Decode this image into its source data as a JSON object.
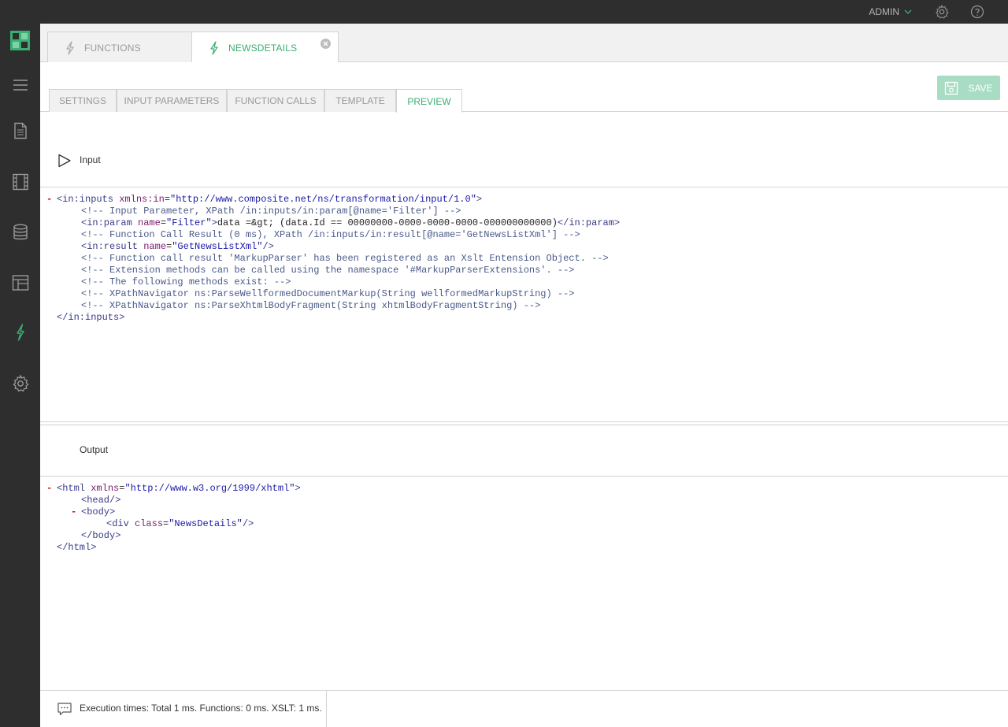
{
  "topbar": {
    "user_label": "ADMIN",
    "icons": [
      "gear-icon",
      "help-icon"
    ]
  },
  "sidebar": {
    "items": [
      {
        "name": "menu-icon"
      },
      {
        "name": "pages-icon"
      },
      {
        "name": "media-icon"
      },
      {
        "name": "data-icon"
      },
      {
        "name": "layout-icon"
      },
      {
        "name": "functions-icon",
        "active": true
      },
      {
        "name": "settings-icon"
      }
    ]
  },
  "doc_tabs": [
    {
      "label": "FUNCTIONS",
      "active": false
    },
    {
      "label": "NEWSDETAILS",
      "active": true
    }
  ],
  "toolbar": {
    "save_label": "SAVE"
  },
  "sub_tabs": [
    {
      "label": "SETTINGS"
    },
    {
      "label": "INPUT PARAMETERS"
    },
    {
      "label": "FUNCTION CALLS"
    },
    {
      "label": "TEMPLATE"
    },
    {
      "label": "PREVIEW",
      "active": true
    }
  ],
  "input_section": {
    "label": "Input",
    "lines": {
      "l1_open": "<in:inputs ",
      "l1_attr": "xmlns:in",
      "l1_eq": "=",
      "l1_val": "\"http://www.composite.net/ns/transformation/input/1.0\"",
      "l1_close": ">",
      "l2": "<!-- Input Parameter, XPath /in:inputs/in:param[@name='Filter'] -->",
      "l3_open": "<in:param ",
      "l3_attr": "name",
      "l3_val": "\"Filter\"",
      "l3_close": ">",
      "l3_text": "data =&gt; (data.Id == 00000000-0000-0000-0000-000000000000)",
      "l3_end": "</in:param>",
      "l4": "<!-- Function Call Result (0 ms), XPath /in:inputs/in:result[@name='GetNewsListXml'] -->",
      "l5_open": "<in:result ",
      "l5_attr": "name",
      "l5_val": "\"GetNewsListXml\"",
      "l5_close": "/>",
      "l6": "<!-- Function call result 'MarkupParser' has been registered as an Xslt Entension Object. -->",
      "l7": "<!-- Extension methods can be called using the namespace '#MarkupParserExtensions'. -->",
      "l8": "<!-- The following methods exist: -->",
      "l9": "<!-- XPathNavigator ns:ParseWellformedDocumentMarkup(String wellformedMarkupString) -->",
      "l10": "<!-- XPathNavigator ns:ParseXhtmlBodyFragment(String xhtmlBodyFragmentString) -->",
      "l11": "</in:inputs>"
    }
  },
  "output_section": {
    "label": "Output",
    "lines": {
      "l1_open": "<html ",
      "l1_attr": "xmlns",
      "l1_val": "\"http://www.w3.org/1999/xhtml\"",
      "l1_close": ">",
      "l2": "<head/>",
      "l3": "<body>",
      "l4_open": "<div ",
      "l4_attr": "class",
      "l4_val": "\"NewsDetails\"",
      "l4_close": "/>",
      "l5": "</body>",
      "l6": "</html>"
    }
  },
  "status": {
    "message": "Execution times: Total 1 ms. Functions: 0 ms. XSLT: 1 ms."
  },
  "colors": {
    "accent": "#3aae73",
    "save_bg": "#a8dcc3",
    "sidebar_bg": "#2e2e2e"
  }
}
